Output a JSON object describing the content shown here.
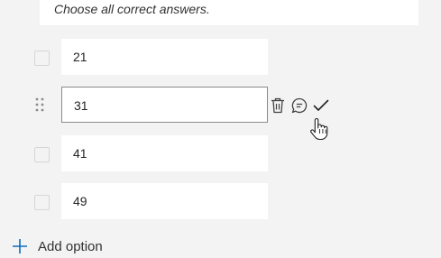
{
  "instruction": {
    "text": "Choose all correct answers."
  },
  "options": [
    {
      "label": "21"
    },
    {
      "label": "31"
    },
    {
      "label": "41"
    },
    {
      "label": "49"
    }
  ],
  "icons": {
    "drag": "drag-handle-icon",
    "delete": "trash-icon",
    "comment": "comment-icon",
    "correct": "checkmark-icon",
    "cursor": "hand-pointer-icon",
    "add": "plus-icon"
  },
  "add_option": {
    "label": "Add option"
  },
  "colors": {
    "background": "#f3f3f3",
    "box": "#ffffff",
    "active_border": "#8a8a8a"
  }
}
